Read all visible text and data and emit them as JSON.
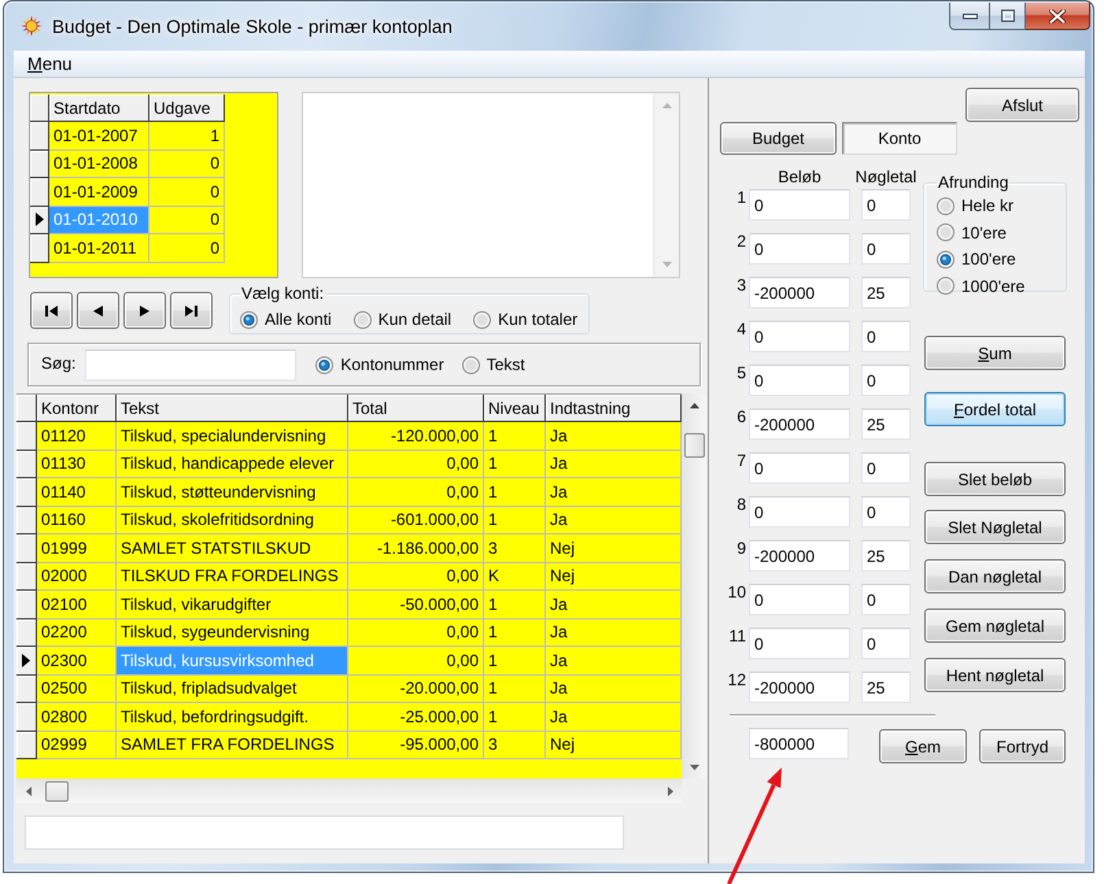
{
  "window": {
    "title": "Budget - Den Optimale Skole - primær kontoplan"
  },
  "menu": [
    {
      "label": "Menu",
      "mnemonic": true
    }
  ],
  "periods": {
    "columns": [
      {
        "label": "Startdato",
        "current": true
      },
      {
        "label": "Udgave",
        "current": false
      }
    ],
    "rows": [
      {
        "cells": [
          "01-01-2007",
          "1"
        ],
        "selected": false
      },
      {
        "cells": [
          "01-01-2008",
          "0"
        ],
        "selected": false
      },
      {
        "cells": [
          "01-01-2009",
          "0"
        ],
        "selected": false
      },
      {
        "cells": [
          "01-01-2010",
          "0"
        ],
        "selected": true
      },
      {
        "cells": [
          "01-01-2011",
          "0"
        ],
        "selected": false
      }
    ]
  },
  "nav_buttons": [
    {
      "kind": "first"
    },
    {
      "kind": "previous"
    },
    {
      "kind": "next"
    },
    {
      "kind": "last"
    }
  ],
  "account_filter": {
    "label": "Vælg konti:",
    "options": [
      {
        "label": "Alle konti",
        "selected": true
      },
      {
        "label": "Kun detail",
        "selected": false
      },
      {
        "label": "Kun totaler",
        "selected": false
      }
    ]
  },
  "search": {
    "label": "Søg:",
    "options": [
      {
        "label": "Kontonummer",
        "selected": true
      },
      {
        "label": "Tekst",
        "selected": false
      }
    ]
  },
  "accounts": {
    "columns": [
      {
        "label": "Kontonr",
        "current": false
      },
      {
        "label": "Tekst",
        "current": true
      },
      {
        "label": "Total",
        "current": false
      },
      {
        "label": "Niveau",
        "current": false
      },
      {
        "label": "Indtastning",
        "current": false
      }
    ],
    "rows": [
      {
        "cells": [
          "01120",
          "Tilskud, specialundervisning",
          "-120.000,00",
          "1",
          "Ja"
        ],
        "selected": false
      },
      {
        "cells": [
          "01130",
          "Tilskud, handicappede elever",
          "0,00",
          "1",
          "Ja"
        ],
        "selected": false
      },
      {
        "cells": [
          "01140",
          "Tilskud, støtteundervisning",
          "0,00",
          "1",
          "Ja"
        ],
        "selected": false
      },
      {
        "cells": [
          "01160",
          "Tilskud, skolefritidsordning",
          "-601.000,00",
          "1",
          "Ja"
        ],
        "selected": false
      },
      {
        "cells": [
          "01999",
          "SAMLET STATSTILSKUD",
          "-1.186.000,00",
          "3",
          "Nej"
        ],
        "selected": false
      },
      {
        "cells": [
          "02000",
          "TILSKUD FRA FORDELINGS",
          "0,00",
          "K",
          "Nej"
        ],
        "selected": false
      },
      {
        "cells": [
          "02100",
          "Tilskud, vikarudgifter",
          "-50.000,00",
          "1",
          "Ja"
        ],
        "selected": false
      },
      {
        "cells": [
          "02200",
          "Tilskud, sygeundervisning",
          "0,00",
          "1",
          "Ja"
        ],
        "selected": false
      },
      {
        "cells": [
          "02300",
          "Tilskud, kursusvirksomhed",
          "0,00",
          "1",
          "Ja"
        ],
        "selected": true
      },
      {
        "cells": [
          "02500",
          "Tilskud, fripladsudvalget",
          "-20.000,00",
          "1",
          "Ja"
        ],
        "selected": false
      },
      {
        "cells": [
          "02800",
          "Tilskud, befordringsudgift.",
          "-25.000,00",
          "1",
          "Ja"
        ],
        "selected": false
      },
      {
        "cells": [
          "02999",
          "SAMLET FRA FORDELINGS",
          "-95.000,00",
          "3",
          "Nej"
        ],
        "selected": false
      }
    ]
  },
  "close_button": {
    "label": "Afslut"
  },
  "tabs": [
    {
      "label": "Budget",
      "selected": false
    },
    {
      "label": "Konto",
      "selected": true
    }
  ],
  "distribution": {
    "columns": [
      "Beløb",
      "Nøgletal"
    ],
    "rows": [
      {
        "number": "1",
        "amount": "0",
        "key_figure": "0"
      },
      {
        "number": "2",
        "amount": "0",
        "key_figure": "0"
      },
      {
        "number": "3",
        "amount": "-200000",
        "key_figure": "25"
      },
      {
        "number": "4",
        "amount": "0",
        "key_figure": "0"
      },
      {
        "number": "5",
        "amount": "0",
        "key_figure": "0"
      },
      {
        "number": "6",
        "amount": "-200000",
        "key_figure": "25"
      },
      {
        "number": "7",
        "amount": "0",
        "key_figure": "0"
      },
      {
        "number": "8",
        "amount": "0",
        "key_figure": "0"
      },
      {
        "number": "9",
        "amount": "-200000",
        "key_figure": "25"
      },
      {
        "number": "10",
        "amount": "0",
        "key_figure": "0"
      },
      {
        "number": "11",
        "amount": "0",
        "key_figure": "0"
      },
      {
        "number": "12",
        "amount": "-200000",
        "key_figure": "25"
      }
    ],
    "total": "-800000"
  },
  "rounding": {
    "label": "Afrunding",
    "options": [
      {
        "label": "Hele kr",
        "selected": false
      },
      {
        "label": "10'ere",
        "selected": false
      },
      {
        "label": "100'ere",
        "selected": true
      },
      {
        "label": "1000'ere",
        "selected": false
      }
    ]
  },
  "action_buttons": [
    {
      "label": "Sum",
      "mnemonic": true,
      "focused": false
    },
    {
      "label": "Fordel total",
      "mnemonic": true,
      "focused": true
    },
    {
      "label": "Slet beløb",
      "mnemonic": false,
      "focused": false
    },
    {
      "label": "Slet Nøgletal",
      "mnemonic": false,
      "focused": false
    },
    {
      "label": "Dan nøgletal",
      "mnemonic": false,
      "focused": false
    },
    {
      "label": "Gem nøgletal",
      "mnemonic": false,
      "focused": false
    },
    {
      "label": "Hent nøgletal",
      "mnemonic": false,
      "focused": false
    }
  ],
  "footer_buttons": [
    {
      "label": "Gem",
      "mnemonic": true
    },
    {
      "label": "Fortryd",
      "mnemonic": false
    }
  ]
}
